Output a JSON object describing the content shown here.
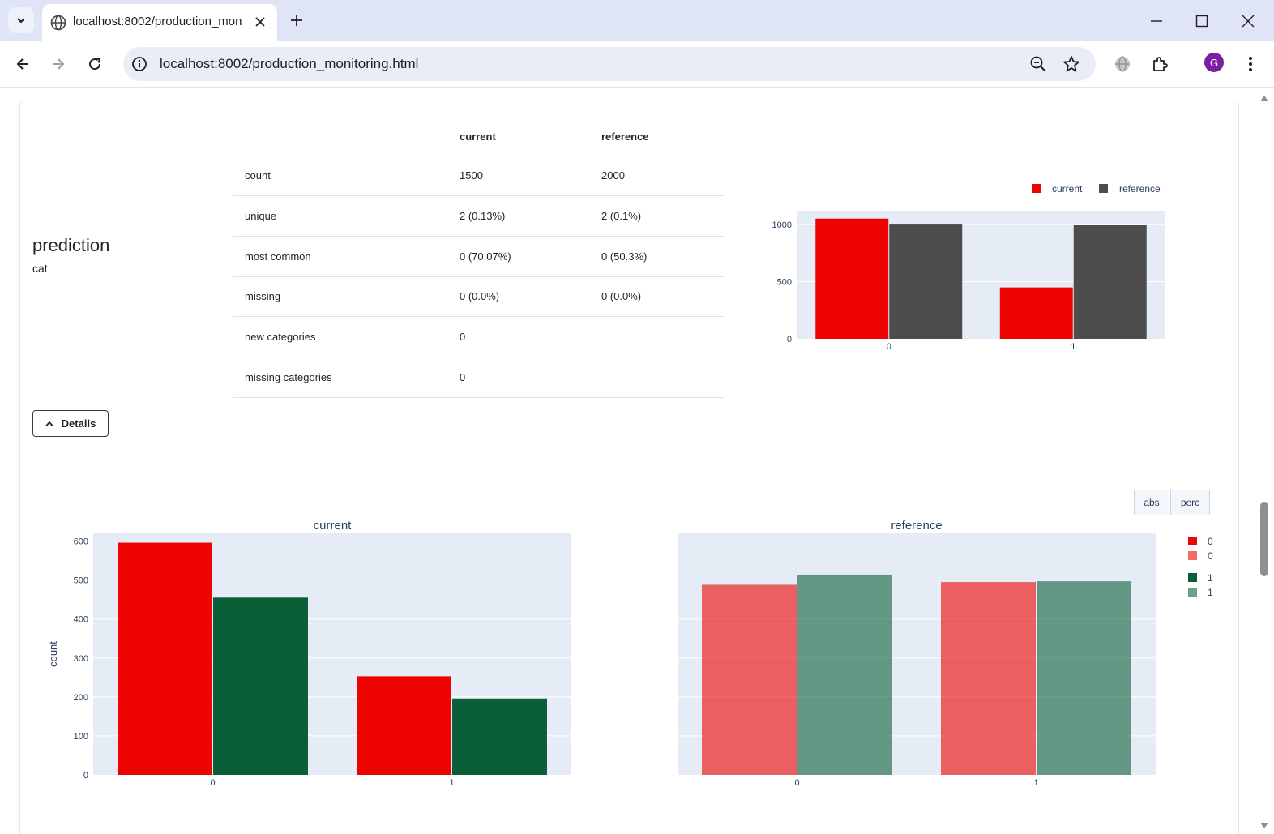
{
  "browser": {
    "tab_title": "localhost:8002/production_mon",
    "url": "localhost:8002/production_monitoring.html",
    "profile_initial": "G"
  },
  "icons": [
    "tab-search-icon",
    "globe-icon",
    "close-icon",
    "plus-icon",
    "minimize-icon",
    "maximize-icon",
    "back-icon",
    "forward-icon",
    "reload-icon",
    "info-icon",
    "zoom-icon",
    "star-icon",
    "extension-globe-icon",
    "puzzle-icon",
    "menu-dots-icon",
    "chevron-up-icon"
  ],
  "feature": {
    "name": "prediction",
    "type": "cat"
  },
  "stats_table": {
    "headers": [
      "",
      "current",
      "reference"
    ],
    "rows": [
      [
        "count",
        "1500",
        "2000"
      ],
      [
        "unique",
        "2 (0.13%)",
        "2 (0.1%)"
      ],
      [
        "most common",
        "0 (70.07%)",
        "0 (50.3%)"
      ],
      [
        "missing",
        "0 (0.0%)",
        "0 (0.0%)"
      ],
      [
        "new categories",
        "0",
        ""
      ],
      [
        "missing categories",
        "0",
        ""
      ]
    ]
  },
  "details_button": "Details",
  "mode_buttons": {
    "abs": "abs",
    "perc": "perc"
  },
  "colors": {
    "current": "#ed0400",
    "reference": "#4d4d4d",
    "class0": "#ed0400",
    "class1": "#0a5f38",
    "plot_bg": "#e5ecf6"
  },
  "chart_data": [
    {
      "type": "bar",
      "categories": [
        "0",
        "1"
      ],
      "series": [
        {
          "name": "current",
          "values": [
            1051,
            449
          ]
        },
        {
          "name": "reference",
          "values": [
            1006,
            994
          ]
        }
      ],
      "ylim": [
        0,
        1120
      ],
      "yticks": [
        0,
        500,
        1000
      ],
      "legend": "top-right",
      "grid": true
    },
    {
      "type": "bar",
      "title": "current",
      "ylabel": "count",
      "categories": [
        "0",
        "1"
      ],
      "series": [
        {
          "name": "0",
          "values": [
            596,
            253
          ]
        },
        {
          "name": "1",
          "values": [
            455,
            196
          ]
        }
      ],
      "ylim": [
        0,
        620
      ],
      "yticks": [
        0,
        100,
        200,
        300,
        400,
        500,
        600
      ],
      "grid": true
    },
    {
      "type": "bar",
      "title": "reference",
      "categories": [
        "0",
        "1"
      ],
      "series": [
        {
          "name": "0",
          "values": [
            488,
            495
          ]
        },
        {
          "name": "1",
          "values": [
            514,
            497
          ]
        }
      ],
      "ylim": [
        0,
        620
      ],
      "legend": "right",
      "legend_entries": [
        "0",
        "0",
        "1",
        "1"
      ],
      "grid": true
    }
  ]
}
